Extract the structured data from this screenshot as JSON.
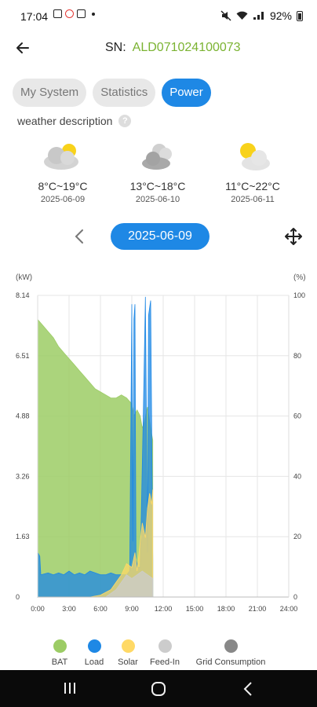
{
  "status_bar": {
    "time": "17:04",
    "battery": "92%"
  },
  "header": {
    "sn_label": "SN:",
    "sn_value": "ALD071024100073"
  },
  "tabs": [
    {
      "label": "My System",
      "active": false
    },
    {
      "label": "Statistics",
      "active": false
    },
    {
      "label": "Power",
      "active": true
    }
  ],
  "weather": {
    "title": "weather description",
    "days": [
      {
        "icon": "cloud-sun-icon",
        "temp": "8°C~19°C",
        "date": "2025-06-09"
      },
      {
        "icon": "cloudy-icon",
        "temp": "13°C~18°C",
        "date": "2025-06-10"
      },
      {
        "icon": "sun-cloud-icon",
        "temp": "11°C~22°C",
        "date": "2025-06-11"
      }
    ]
  },
  "date_nav": {
    "date": "2025-06-09"
  },
  "colors": {
    "bat": "#9ccc65",
    "load": "#1e88e5",
    "solar": "#ffd966",
    "feed_in": "#cccccc",
    "grid": "#888888",
    "accent": "#1e88e5",
    "sn_green": "#7bb332"
  },
  "chart_data": {
    "type": "area",
    "left_unit": "(kW)",
    "right_unit": "(%)",
    "y_left_ticks": [
      "8.14",
      "6.51",
      "4.88",
      "3.26",
      "1.63",
      "0"
    ],
    "y_right_ticks": [
      "100",
      "80",
      "60",
      "40",
      "20",
      "0"
    ],
    "ylim_left": [
      0,
      8.14
    ],
    "ylim_right": [
      0,
      100
    ],
    "x_ticks": [
      "0:00",
      "3:00",
      "6:00",
      "9:00",
      "12:00",
      "15:00",
      "18:00",
      "21:00",
      "24:00"
    ],
    "xlim": [
      0,
      24
    ],
    "grid": true,
    "legend_position": "bottom",
    "series": [
      {
        "name": "BAT",
        "axis": "right",
        "color": "#9ccc65",
        "points": [
          [
            0,
            92
          ],
          [
            0.5,
            90
          ],
          [
            1,
            88
          ],
          [
            1.5,
            86
          ],
          [
            2,
            83
          ],
          [
            2.5,
            81
          ],
          [
            3,
            79
          ],
          [
            3.5,
            77
          ],
          [
            4,
            75
          ],
          [
            4.5,
            73
          ],
          [
            5,
            71
          ],
          [
            5.5,
            69
          ],
          [
            6,
            68
          ],
          [
            6.5,
            67
          ],
          [
            7,
            66
          ],
          [
            7.5,
            66
          ],
          [
            8,
            67
          ],
          [
            8.5,
            66
          ],
          [
            9,
            64
          ],
          [
            9.2,
            60
          ],
          [
            9.5,
            62
          ],
          [
            9.8,
            60
          ],
          [
            10,
            56
          ],
          [
            10.2,
            58
          ],
          [
            10.5,
            63
          ],
          [
            10.8,
            56
          ],
          [
            11,
            52
          ],
          [
            11,
            0
          ]
        ]
      },
      {
        "name": "Load",
        "axis": "left",
        "color": "#1e88e5",
        "points": [
          [
            0,
            1.2
          ],
          [
            0.2,
            1.1
          ],
          [
            0.3,
            0.6
          ],
          [
            1,
            0.65
          ],
          [
            1.5,
            0.6
          ],
          [
            2,
            0.65
          ],
          [
            2.5,
            0.6
          ],
          [
            3,
            0.7
          ],
          [
            3.5,
            0.6
          ],
          [
            4,
            0.65
          ],
          [
            4.5,
            0.6
          ],
          [
            5,
            0.7
          ],
          [
            5.5,
            0.65
          ],
          [
            6,
            0.6
          ],
          [
            6.5,
            0.6
          ],
          [
            7,
            0.65
          ],
          [
            7.5,
            0.6
          ],
          [
            8,
            0.6
          ],
          [
            8.5,
            0.6
          ],
          [
            8.8,
            0.7
          ],
          [
            9,
            7.9
          ],
          [
            9.1,
            1.5
          ],
          [
            9.2,
            7.5
          ],
          [
            9.3,
            7.9
          ],
          [
            9.4,
            1.0
          ],
          [
            9.6,
            0.8
          ],
          [
            9.8,
            0.8
          ],
          [
            10.1,
            5.0
          ],
          [
            10.3,
            8.1
          ],
          [
            10.5,
            1.2
          ],
          [
            10.6,
            7.6
          ],
          [
            10.8,
            8.0
          ],
          [
            11,
            1.0
          ],
          [
            11,
            0
          ]
        ]
      },
      {
        "name": "Solar",
        "axis": "left",
        "color": "#ffd966",
        "points": [
          [
            5,
            0
          ],
          [
            6,
            0.05
          ],
          [
            7,
            0.2
          ],
          [
            7.5,
            0.4
          ],
          [
            8,
            0.6
          ],
          [
            8.5,
            0.9
          ],
          [
            9,
            0.8
          ],
          [
            9.3,
            1.2
          ],
          [
            9.5,
            0.7
          ],
          [
            9.8,
            1.5
          ],
          [
            10,
            2.0
          ],
          [
            10.3,
            1.6
          ],
          [
            10.5,
            2.4
          ],
          [
            10.7,
            2.8
          ],
          [
            10.9,
            2.5
          ],
          [
            11,
            2.9
          ],
          [
            11,
            0
          ]
        ]
      },
      {
        "name": "Feed-In",
        "axis": "left",
        "color": "#cccccc",
        "points": [
          [
            6.5,
            0
          ],
          [
            7,
            0.1
          ],
          [
            7.5,
            0.2
          ],
          [
            8,
            0.4
          ],
          [
            8.5,
            0.6
          ],
          [
            9,
            0.5
          ],
          [
            9.5,
            0.6
          ],
          [
            10,
            0.7
          ],
          [
            10.5,
            0.6
          ],
          [
            11,
            0.5
          ],
          [
            11,
            0
          ]
        ]
      },
      {
        "name": "Grid Consumption",
        "axis": "left",
        "color": "#888888",
        "points": []
      }
    ]
  },
  "legend": [
    {
      "label": "BAT",
      "color": "#9ccc65"
    },
    {
      "label": "Load",
      "color": "#1e88e5"
    },
    {
      "label": "Solar",
      "color": "#ffd966"
    },
    {
      "label": "Feed-In",
      "color": "#cccccc"
    },
    {
      "label": "Grid Consumption",
      "color": "#888888"
    }
  ]
}
